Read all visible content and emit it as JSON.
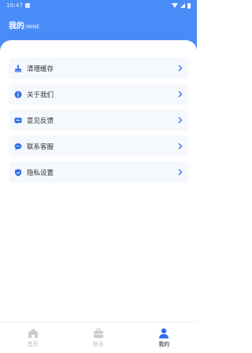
{
  "status_bar": {
    "time": "10:47"
  },
  "header": {
    "title": "我的",
    "subtitle": "/MINE"
  },
  "menu": [
    {
      "label": "清理缓存",
      "icon": "broom-icon"
    },
    {
      "label": "关于我们",
      "icon": "info-icon"
    },
    {
      "label": "意见反馈",
      "icon": "feedback-icon"
    },
    {
      "label": "联系客服",
      "icon": "chat-icon"
    },
    {
      "label": "隐私设置",
      "icon": "shield-icon"
    }
  ],
  "tabs": [
    {
      "label": "首页",
      "icon": "home-icon",
      "active": false
    },
    {
      "label": "助手",
      "icon": "briefcase-icon",
      "active": false
    },
    {
      "label": "我的",
      "icon": "user-icon",
      "active": true
    }
  ],
  "colors": {
    "accent": "#4a8cf7",
    "item_bg": "#f5f8fd",
    "inactive_tab": "#cccccc"
  }
}
